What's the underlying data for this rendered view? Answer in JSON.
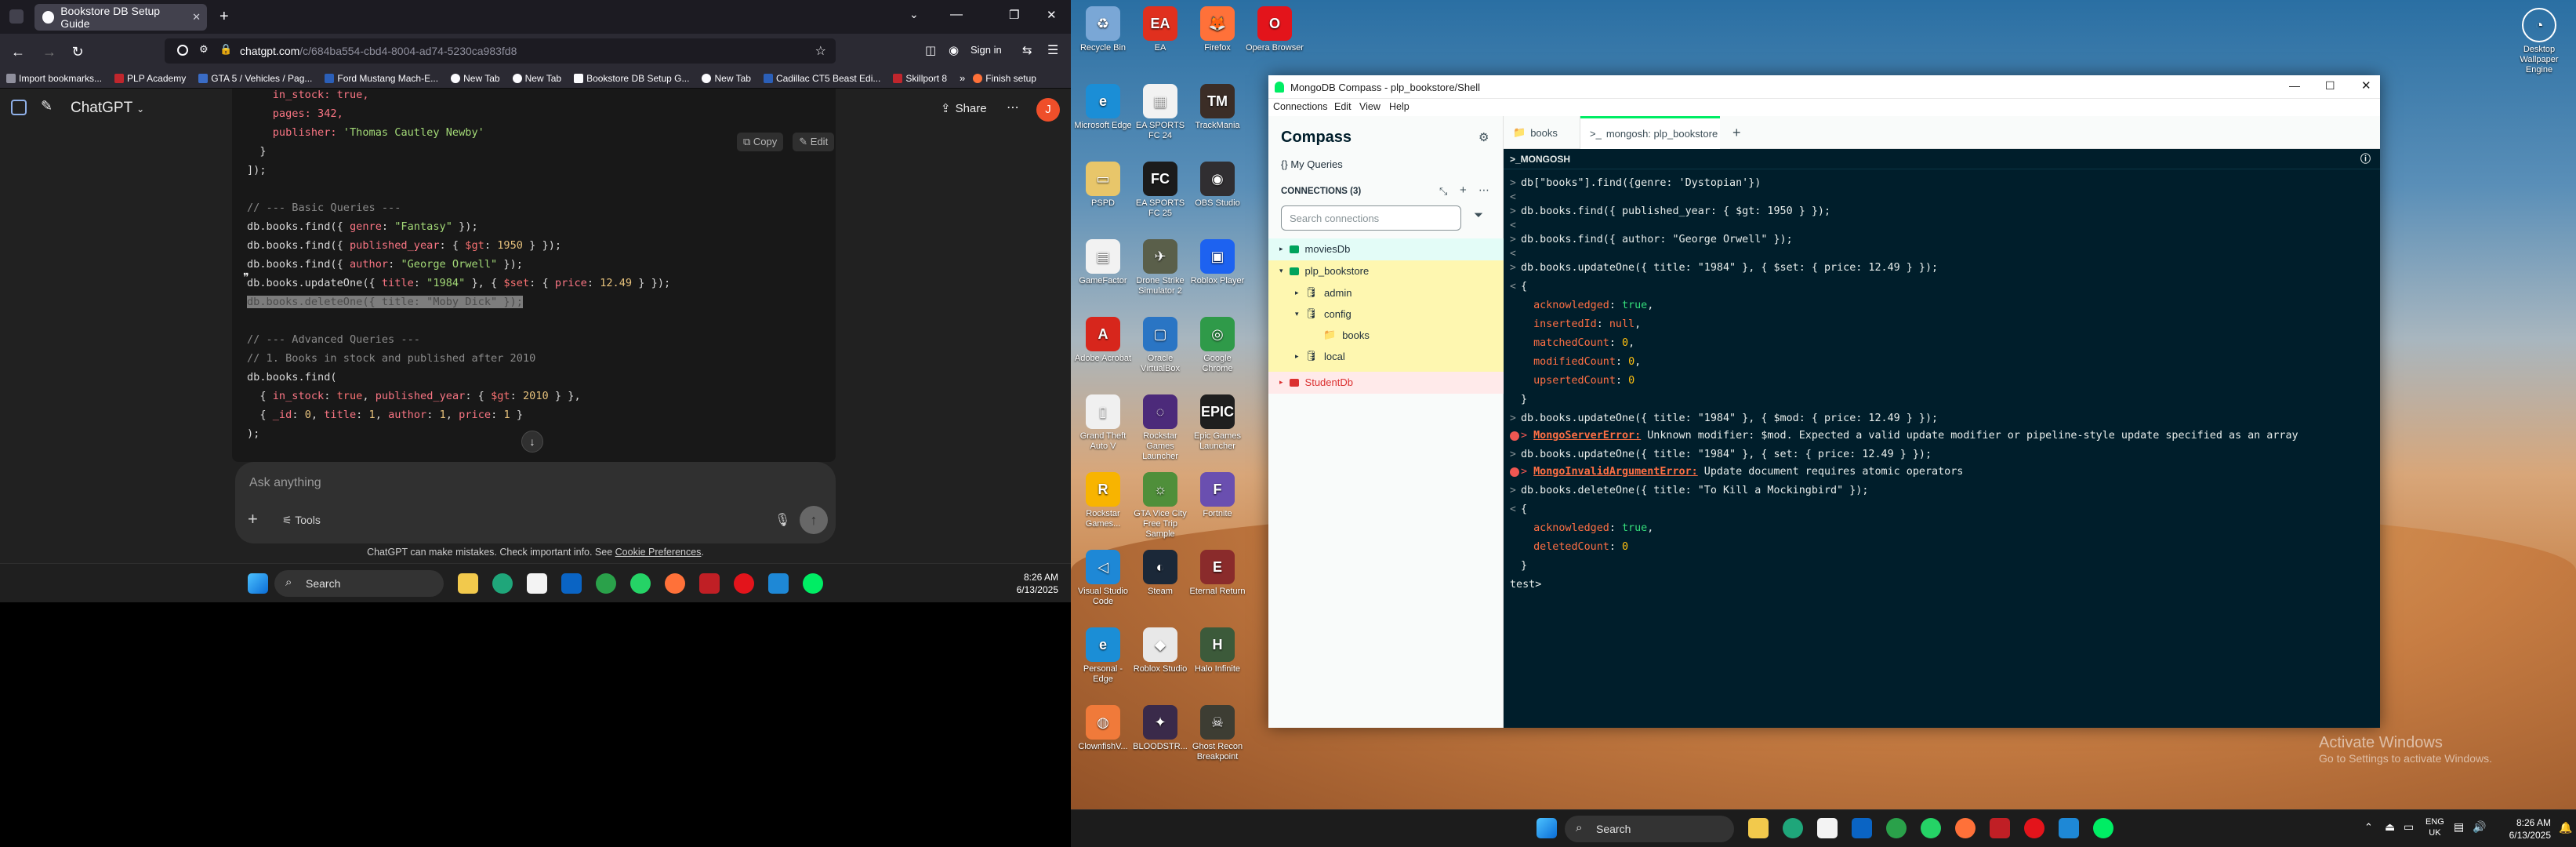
{
  "left": {
    "browser_tab_title": "Bookstore DB Setup Guide",
    "url_host": "chatgpt.com",
    "url_rest": "/c/684ba554-cbd4-8004-ad74-5230ca983fd8",
    "sign_in": "Sign in",
    "bookmarks": [
      "Import bookmarks...",
      "PLP Academy",
      "GTA 5 / Vehicles / Pag...",
      "Ford Mustang Mach-E...",
      "New Tab",
      "New Tab",
      "Bookstore DB Setup G...",
      "New Tab",
      "Cadillac CT5 Beast Edi...",
      "Skillport 8",
      "Finish setup"
    ],
    "app_title": "ChatGPT",
    "share": "Share",
    "avatar_letter": "J",
    "copy": "Copy",
    "edit": "Edit",
    "code": {
      "l1": "in_stock: true,",
      "l2": "pages: 342,",
      "l3a": "publisher: ",
      "l3b": "'Thomas Cautley Newby'",
      "l4": "}",
      "l5": "]);",
      "l6": "// --- Basic Queries ---",
      "l7a": "db.books.find({ ",
      "l7b": "genre",
      "l7c": ": ",
      "l7d": "\"Fantasy\"",
      "l7e": " });",
      "l8a": "db.books.find({ ",
      "l8b": "published_year",
      "l8c": ": { ",
      "l8d": "$gt",
      "l8e": ": ",
      "l8f": "1950",
      "l8g": " } });",
      "l9a": "db.books.find({ ",
      "l9b": "author",
      "l9c": ": ",
      "l9d": "\"George Orwell\"",
      "l9e": " });",
      "l10a": "db.books.updateOne({ ",
      "l10b": "title",
      "l10c": ": ",
      "l10d": "\"1984\"",
      "l10e": " }, { ",
      "l10f": "$set",
      "l10g": ": { ",
      "l10h": "price",
      "l10i": ": ",
      "l10j": "12.49",
      "l10k": " } });",
      "l11": "db.books.deleteOne({ title: \"Moby Dick\" });",
      "l12": "// --- Advanced Queries ---",
      "l13": "// 1. Books in stock and published after 2010",
      "l14": "db.books.find(",
      "l15a": "  { ",
      "l15b": "in_stock",
      "l15c": ": ",
      "l15d": "true",
      "l15e": ", ",
      "l15f": "published_year",
      "l15g": ": { ",
      "l15h": "$gt",
      "l15i": ": ",
      "l15j": "2010",
      "l15k": " } },",
      "l16a": "  { ",
      "l16b": "_id",
      "l16c": ": ",
      "l16d": "0",
      "l16e": ", ",
      "l16f": "title",
      "l16g": ": ",
      "l16h": "1",
      "l16i": ", ",
      "l16j": "author",
      "l16k": ": ",
      "l16l": "1",
      "l16m": ", ",
      "l16n": "price",
      "l16o": ": ",
      "l16p": "1",
      "l16q": " }",
      "l17": ");"
    },
    "composer_placeholder": "Ask anything",
    "tools": "Tools",
    "disclaimer": "ChatGPT can make mistakes. Check important info. See ",
    "disclaimer_link": "Cookie Preferences",
    "disclaimer_end": ".",
    "search": "Search",
    "time": "8:26 AM",
    "date": "6/13/2025"
  },
  "right": {
    "desktop_icons": [
      {
        "label": "Recycle Bin",
        "color": "#7aa7d6",
        "glyph": "♻"
      },
      {
        "label": "EA",
        "color": "#e0301e",
        "glyph": "EA"
      },
      {
        "label": "Firefox",
        "color": "#ff7139",
        "glyph": "🦊"
      },
      {
        "label": "Opera Browser",
        "color": "#e3141b",
        "glyph": "O"
      },
      {
        "label": "Microsoft Edge",
        "color": "#1b8ed6",
        "glyph": "e"
      },
      {
        "label": "EA SPORTS FC 24",
        "color": "#f2f2f2",
        "glyph": "▦"
      },
      {
        "label": "TrackMania",
        "color": "#3b2d26",
        "glyph": "TM"
      },
      {
        "label": "PSPD",
        "color": "#e8c66a",
        "glyph": "▭"
      },
      {
        "label": "EA SPORTS FC 25",
        "color": "#1b1b1b",
        "glyph": "FC"
      },
      {
        "label": "OBS Studio",
        "color": "#302e31",
        "glyph": "◉"
      },
      {
        "label": "GameFactor",
        "color": "#f2f2f2",
        "glyph": "▤"
      },
      {
        "label": "Drone Strike Simulator 2",
        "color": "#5a5f4a",
        "glyph": "✈"
      },
      {
        "label": "Roblox Player",
        "color": "#1d62f0",
        "glyph": "▣"
      },
      {
        "label": "Adobe Acrobat",
        "color": "#d7261c",
        "glyph": "A"
      },
      {
        "label": "Oracle VirtualBox",
        "color": "#2a75c4",
        "glyph": "▢"
      },
      {
        "label": "Google Chrome",
        "color": "#2f9a49",
        "glyph": "◎"
      },
      {
        "label": "Grand Theft Auto V",
        "color": "#f0f0f0",
        "glyph": "▯"
      },
      {
        "label": "Rockstar Games Launcher",
        "color": "#4c2a7a",
        "glyph": "◌"
      },
      {
        "label": "Epic Games Launcher",
        "color": "#1f1f1f",
        "glyph": "EPIC"
      },
      {
        "label": "Rockstar Games...",
        "color": "#f8b400",
        "glyph": "R"
      },
      {
        "label": "GTA Vice City Free Trip Sample",
        "color": "#4f8f3a",
        "glyph": "☼"
      },
      {
        "label": "Fortnite",
        "color": "#6a4fb0",
        "glyph": "F"
      },
      {
        "label": "Visual Studio Code",
        "color": "#1e88d6",
        "glyph": "◁"
      },
      {
        "label": "Steam",
        "color": "#1b2838",
        "glyph": "◐"
      },
      {
        "label": "Eternal Return",
        "color": "#8a2b2b",
        "glyph": "E"
      },
      {
        "label": "Personal - Edge",
        "color": "#1b8ed6",
        "glyph": "e"
      },
      {
        "label": "Roblox Studio",
        "color": "#e8e8e8",
        "glyph": "◆"
      },
      {
        "label": "Halo Infinite",
        "color": "#3c5a3a",
        "glyph": "H"
      },
      {
        "label": "ClownfishV...",
        "color": "#f07a3a",
        "glyph": "◍"
      },
      {
        "label": "BLOODSTR...",
        "color": "#3a2a4a",
        "glyph": "✦"
      },
      {
        "label": "Ghost Recon Breakpoint",
        "color": "#3d3d33",
        "glyph": "☠"
      }
    ],
    "top_right_icon": "Desktop Wallpaper Engine",
    "compass": {
      "window_title": "MongoDB Compass - plp_bookstore/Shell",
      "menu": [
        "Connections",
        "Edit",
        "View",
        "Help"
      ],
      "brand": "Compass",
      "my_queries": "My Queries",
      "connections_header": "CONNECTIONS (3)",
      "search_placeholder": "Search connections",
      "tree": {
        "c1": "moviesDb",
        "c2": "plp_bookstore",
        "db1": "admin",
        "db2": "config",
        "coll": "books",
        "db3": "local",
        "c3": "StudentDb"
      },
      "tabs": [
        "books",
        "mongosh: plp_bookstore"
      ],
      "shell_header": ">_MONGOSH",
      "shell": {
        "s1": "db[\"books\"].find({genre: 'Dystopian'})",
        "s2": "db.books.find({ published_year: { $gt: 1950 } });",
        "s3": "db.books.find({ author: \"George Orwell\" });",
        "s4": "db.books.updateOne({ title: \"1984\" }, { $set: { price: 12.49 } });",
        "o1": "{",
        "o2k": "acknowledged",
        "o2v": "true",
        "o3k": "insertedId",
        "o3v": "null",
        "o4k": "matchedCount",
        "o4v": "0",
        "o5k": "modifiedCount",
        "o5v": "0",
        "o6k": "upsertedCount",
        "o6v": "0",
        "o7": "}",
        "s5": "db.books.updateOne({ title: \"1984\" }, { $mod: { price: 12.49 } });",
        "e1": "MongoServerError:",
        "e1t": " Unknown modifier: $mod. Expected a valid update modifier or pipeline-style update specified as an array",
        "s6": "db.books.updateOne({ title: \"1984\" }, { set: { price: 12.49 } });",
        "e2": "MongoInvalidArgumentError:",
        "e2t": " Update document requires atomic operators",
        "s7": "db.books.deleteOne({ title: \"To Kill a Mockingbird\" });",
        "p1": "{",
        "p2k": "acknowledged",
        "p2v": "true",
        "p3k": "deletedCount",
        "p3v": "0",
        "p4": "}",
        "prompt": "test>"
      }
    },
    "activate_title": "Activate Windows",
    "activate_sub": "Go to Settings to activate Windows.",
    "search": "Search",
    "lang1": "ENG",
    "lang2": "UK",
    "time": "8:26 AM",
    "date": "6/13/2025"
  }
}
